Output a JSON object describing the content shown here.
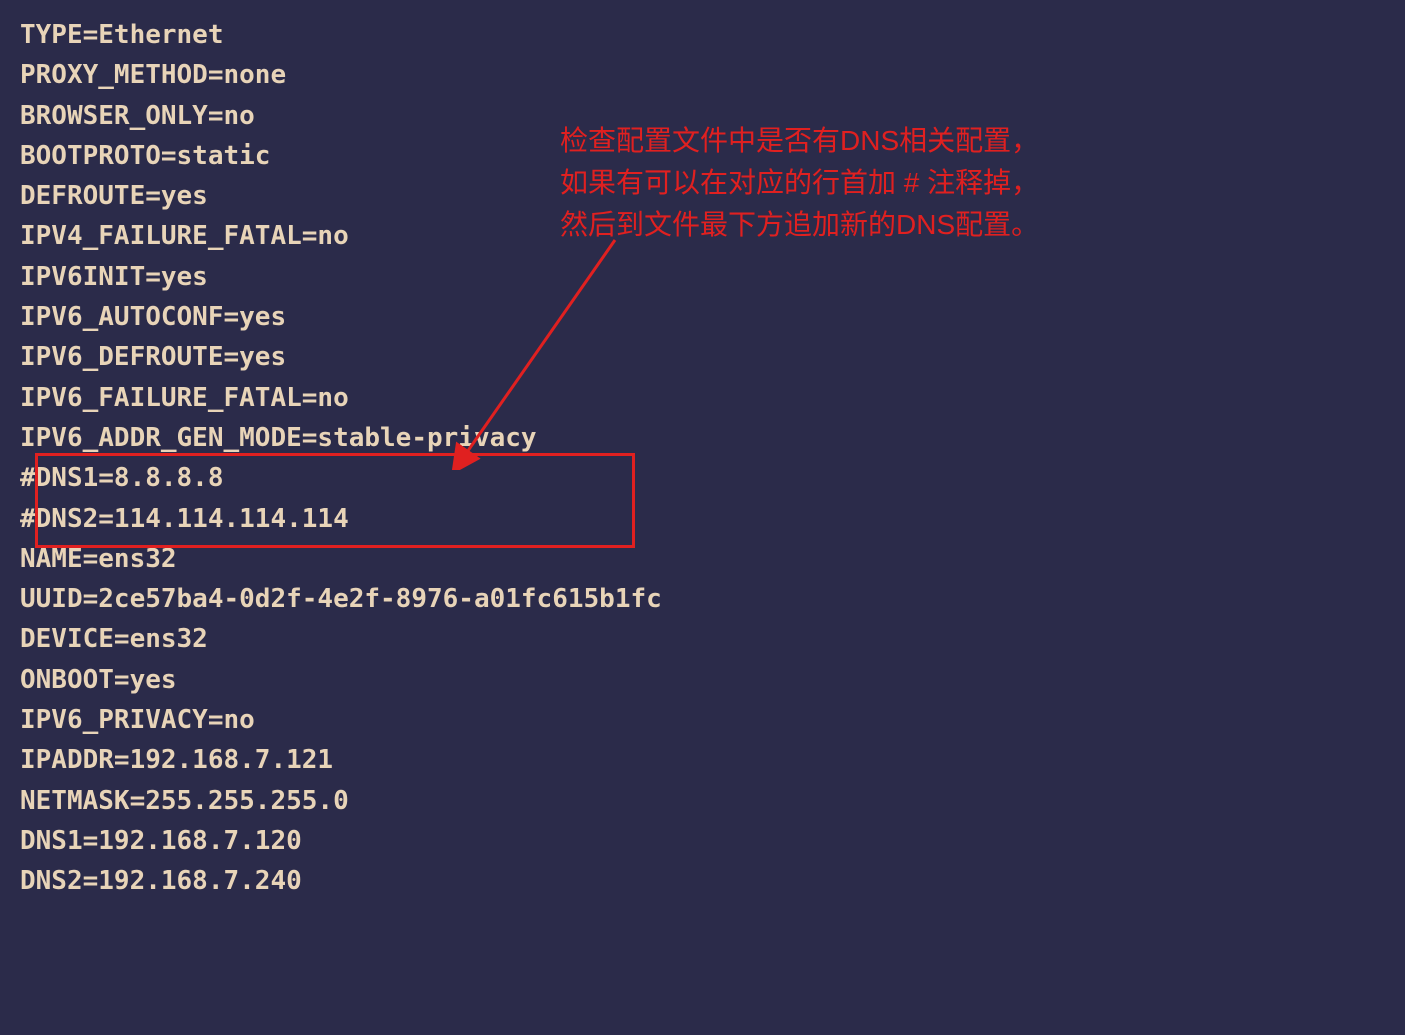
{
  "config": {
    "lines": [
      "TYPE=Ethernet",
      "PROXY_METHOD=none",
      "BROWSER_ONLY=no",
      "BOOTPROTO=static",
      "DEFROUTE=yes",
      "IPV4_FAILURE_FATAL=no",
      "IPV6INIT=yes",
      "IPV6_AUTOCONF=yes",
      "IPV6_DEFROUTE=yes",
      "IPV6_FAILURE_FATAL=no",
      "IPV6_ADDR_GEN_MODE=stable-privacy",
      "#DNS1=8.8.8.8",
      "#DNS2=114.114.114.114",
      "NAME=ens32",
      "UUID=2ce57ba4-0d2f-4e2f-8976-a01fc615b1fc",
      "DEVICE=ens32",
      "ONBOOT=yes",
      "IPV6_PRIVACY=no",
      "IPADDR=192.168.7.121",
      "NETMASK=255.255.255.0",
      "DNS1=192.168.7.120",
      "DNS2=192.168.7.240"
    ]
  },
  "annotation": {
    "text": "检查配置文件中是否有DNS相关配置，\n如果有可以在对应的行首加 # 注释掉，\n然后到文件最下方追加新的DNS配置。"
  },
  "colors": {
    "background": "#2b2b4a",
    "text": "#e8d4b8",
    "highlight": "#e02020"
  }
}
